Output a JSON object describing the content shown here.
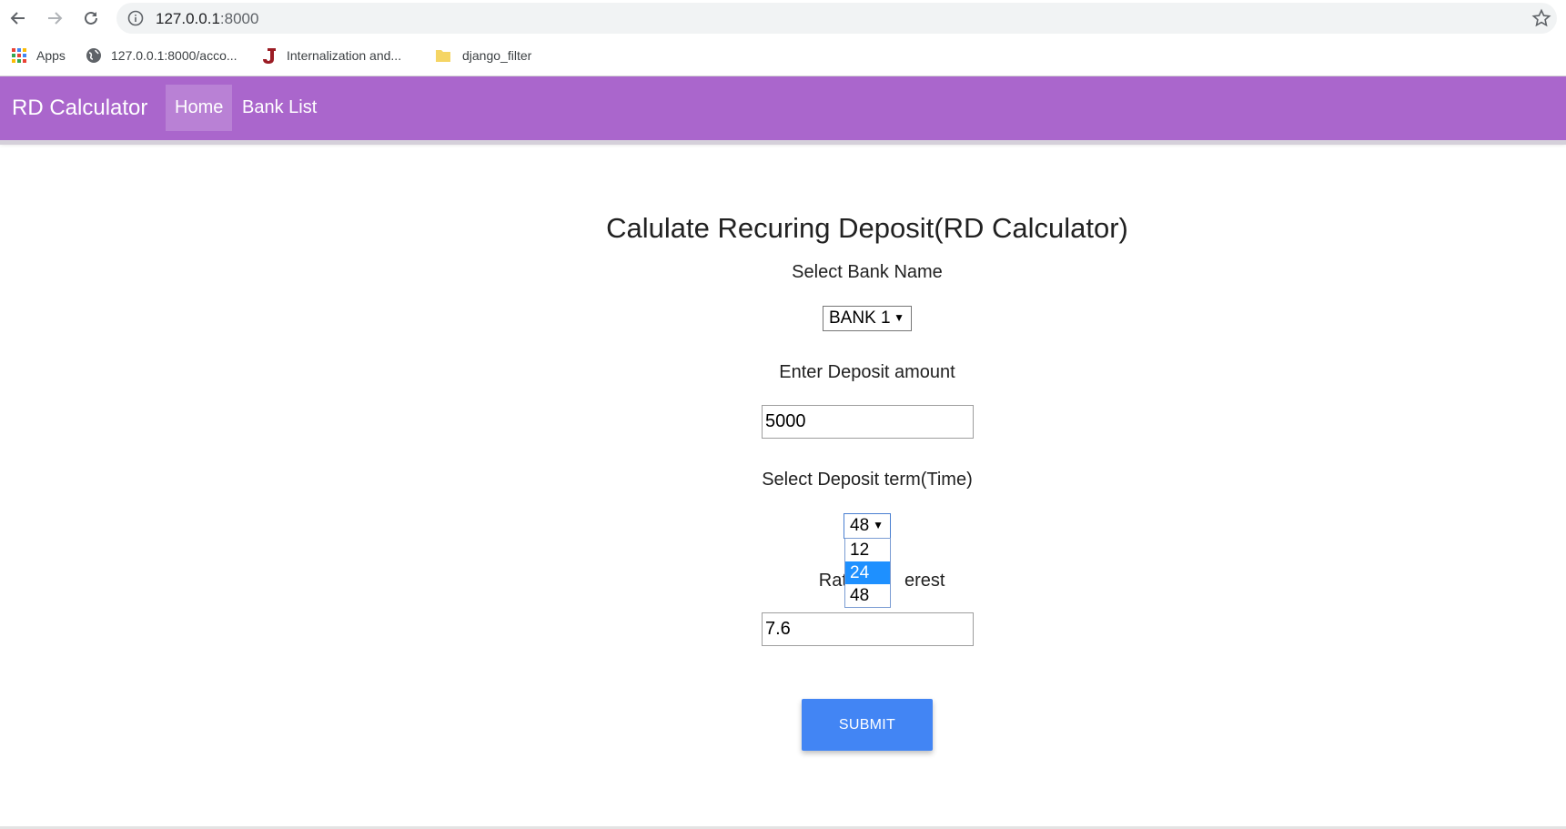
{
  "browser": {
    "url_host": "127.0.0.1",
    "url_port": ":8000",
    "bookmarks": [
      {
        "label": "Apps",
        "icon": "apps-grid-icon"
      },
      {
        "label": "127.0.0.1:8000/acco...",
        "icon": "globe-icon"
      },
      {
        "label": "Internalization and...",
        "icon": "j-logo-icon"
      },
      {
        "label": "django_filter",
        "icon": "folder-icon"
      }
    ]
  },
  "navbar": {
    "brand": "RD Calculator",
    "links": [
      {
        "label": "Home",
        "active": true
      },
      {
        "label": "Bank List",
        "active": false
      }
    ],
    "color": "#aa66cc"
  },
  "form": {
    "title": "Calulate Recuring Deposit(RD Calculator)",
    "bank_label": "Select Bank Name",
    "bank_selected": "BANK 1",
    "amount_label": "Enter Deposit amount",
    "amount_value": "5000",
    "term_label": "Select Deposit term(Time)",
    "term_selected": "48",
    "term_options": [
      "12",
      "24",
      "48"
    ],
    "term_highlighted": "24",
    "rate_label_left": "Rate",
    "rate_label_right": "erest",
    "rate_value": "7.6",
    "submit_label": "SUBMIT",
    "submit_color": "#4285f4"
  }
}
